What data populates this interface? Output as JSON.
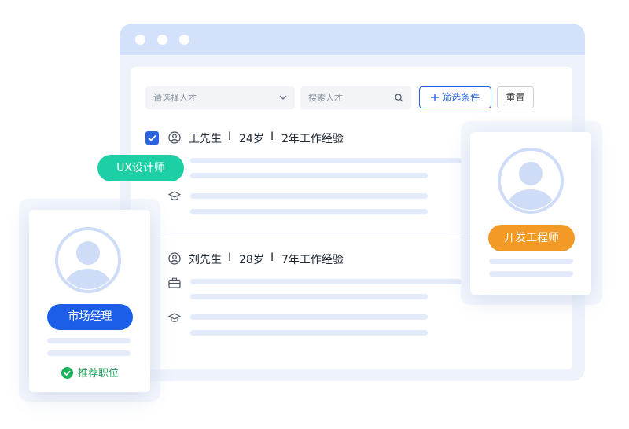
{
  "toolbar": {
    "select_placeholder": "请选择人才",
    "search_placeholder": "搜索人才",
    "filter_label": "筛选条件",
    "filter_icon": "plus-icon",
    "reset_label": "重置"
  },
  "candidates": [
    {
      "name": "王先生",
      "age": "24岁",
      "experience": "2年工作经验",
      "checked": true
    },
    {
      "name": "刘先生",
      "age": "28岁",
      "experience": "7年工作经验",
      "checked": false
    }
  ],
  "separator": "I",
  "tags": {
    "ux": "UX设计师",
    "market": "市场经理",
    "developer": "开发工程师"
  },
  "recommend_label": "推荐职位",
  "colors": {
    "accent": "#2563eb",
    "teal_tag": "#1ccfa4",
    "blue_tag": "#1d5ee8",
    "orange_tag": "#f39a26",
    "success": "#1bb45c"
  }
}
